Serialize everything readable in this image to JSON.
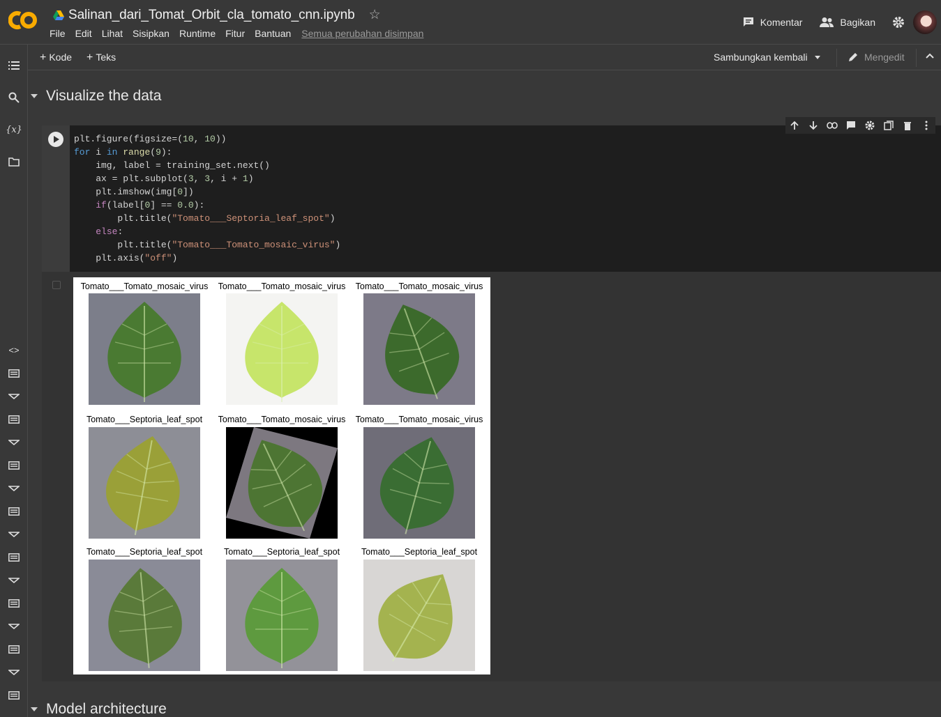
{
  "header": {
    "title": "Salinan_dari_Tomat_Orbit_cla_tomato_cnn.ipynb",
    "menu": [
      "File",
      "Edit",
      "Lihat",
      "Sisipkan",
      "Runtime",
      "Fitur",
      "Bantuan"
    ],
    "saved_status": "Semua perubahan disimpan",
    "comment_label": "Komentar",
    "share_label": "Bagikan"
  },
  "toolbar": {
    "add_code": "Kode",
    "add_text": "Teks",
    "reconnect": "Sambungkan kembali",
    "editing": "Mengedit"
  },
  "sections": {
    "visualize": "Visualize the data",
    "model": "Model architecture"
  },
  "figure": {
    "titles": [
      "Tomato___Tomato_mosaic_virus",
      "Tomato___Tomato_mosaic_virus",
      "Tomato___Tomato_mosaic_virus",
      "Tomato___Septoria_leaf_spot",
      "Tomato___Tomato_mosaic_virus",
      "Tomato___Tomato_mosaic_virus",
      "Tomato___Septoria_leaf_spot",
      "Tomato___Septoria_leaf_spot",
      "Tomato___Septoria_leaf_spot"
    ]
  },
  "colors": {
    "background": "#383838",
    "code_bg": "#1e1e1e",
    "keyword": "#569cd6",
    "string": "#ce9178",
    "number": "#b5cea8"
  }
}
